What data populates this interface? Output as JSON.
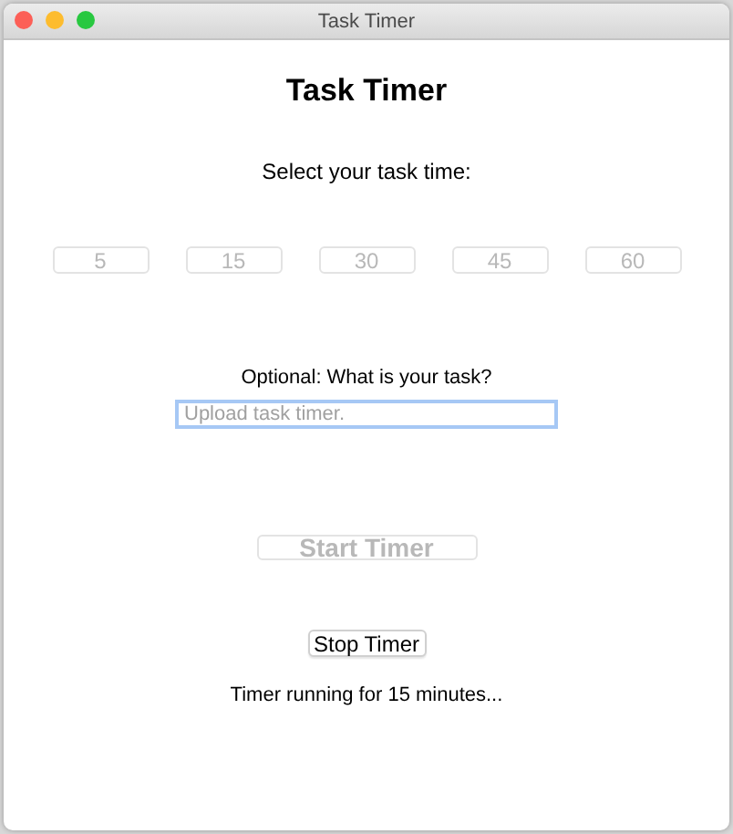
{
  "window": {
    "title": "Task Timer"
  },
  "heading": "Task Timer",
  "prompt": "Select your task time:",
  "time_buttons": [
    {
      "label": "5",
      "disabled": true
    },
    {
      "label": "15",
      "disabled": true
    },
    {
      "label": "30",
      "disabled": true
    },
    {
      "label": "45",
      "disabled": true
    },
    {
      "label": "60",
      "disabled": true
    }
  ],
  "task_label": "Optional: What is your task?",
  "task_field": {
    "placeholder": "Upload task timer.",
    "focused": true
  },
  "start_button": {
    "label": "Start Timer",
    "disabled": true
  },
  "stop_button": {
    "label": "Stop Timer",
    "disabled": false
  },
  "status": "Timer running for 15 minutes..."
}
